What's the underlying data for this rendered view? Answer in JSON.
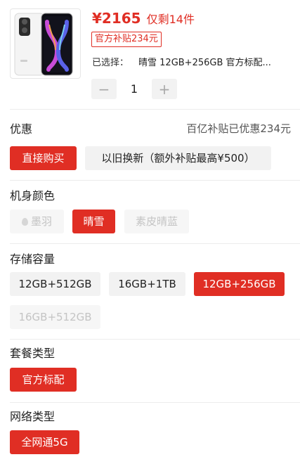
{
  "product": {
    "price": "¥2165",
    "stock_text": "仅剩14件",
    "subsidy_tag": "官方补贴234元",
    "selected_label": "已选择：",
    "selected_value": "晴雪 12GB+256GB 官方标配...",
    "quantity": "1",
    "minus": "−",
    "plus": "+"
  },
  "promo": {
    "title": "优惠",
    "value": "百亿补贴已优惠234元"
  },
  "purchase": {
    "options": [
      {
        "label": "直接购买",
        "state": "active"
      },
      {
        "label": "以旧换新（额外补贴最高¥500）",
        "state": "normal"
      }
    ]
  },
  "color": {
    "title": "机身颜色",
    "options": [
      {
        "label": "墨羽",
        "state": "disabled"
      },
      {
        "label": "晴雪",
        "state": "active"
      },
      {
        "label": "素皮晴蓝",
        "state": "disabled"
      }
    ]
  },
  "storage": {
    "title": "存储容量",
    "options": [
      {
        "label": "12GB+512GB",
        "state": "normal"
      },
      {
        "label": "16GB+1TB",
        "state": "normal"
      },
      {
        "label": "12GB+256GB",
        "state": "active"
      },
      {
        "label": "16GB+512GB",
        "state": "disabled"
      }
    ]
  },
  "package": {
    "title": "套餐类型",
    "options": [
      {
        "label": "官方标配",
        "state": "active"
      }
    ]
  },
  "network": {
    "title": "网络类型",
    "options": [
      {
        "label": "全网通5G",
        "state": "active"
      }
    ]
  },
  "colors": {
    "accent": "#e02e24",
    "option_bg": "#f2f2f2",
    "disabled_text": "#c4c4c4"
  }
}
